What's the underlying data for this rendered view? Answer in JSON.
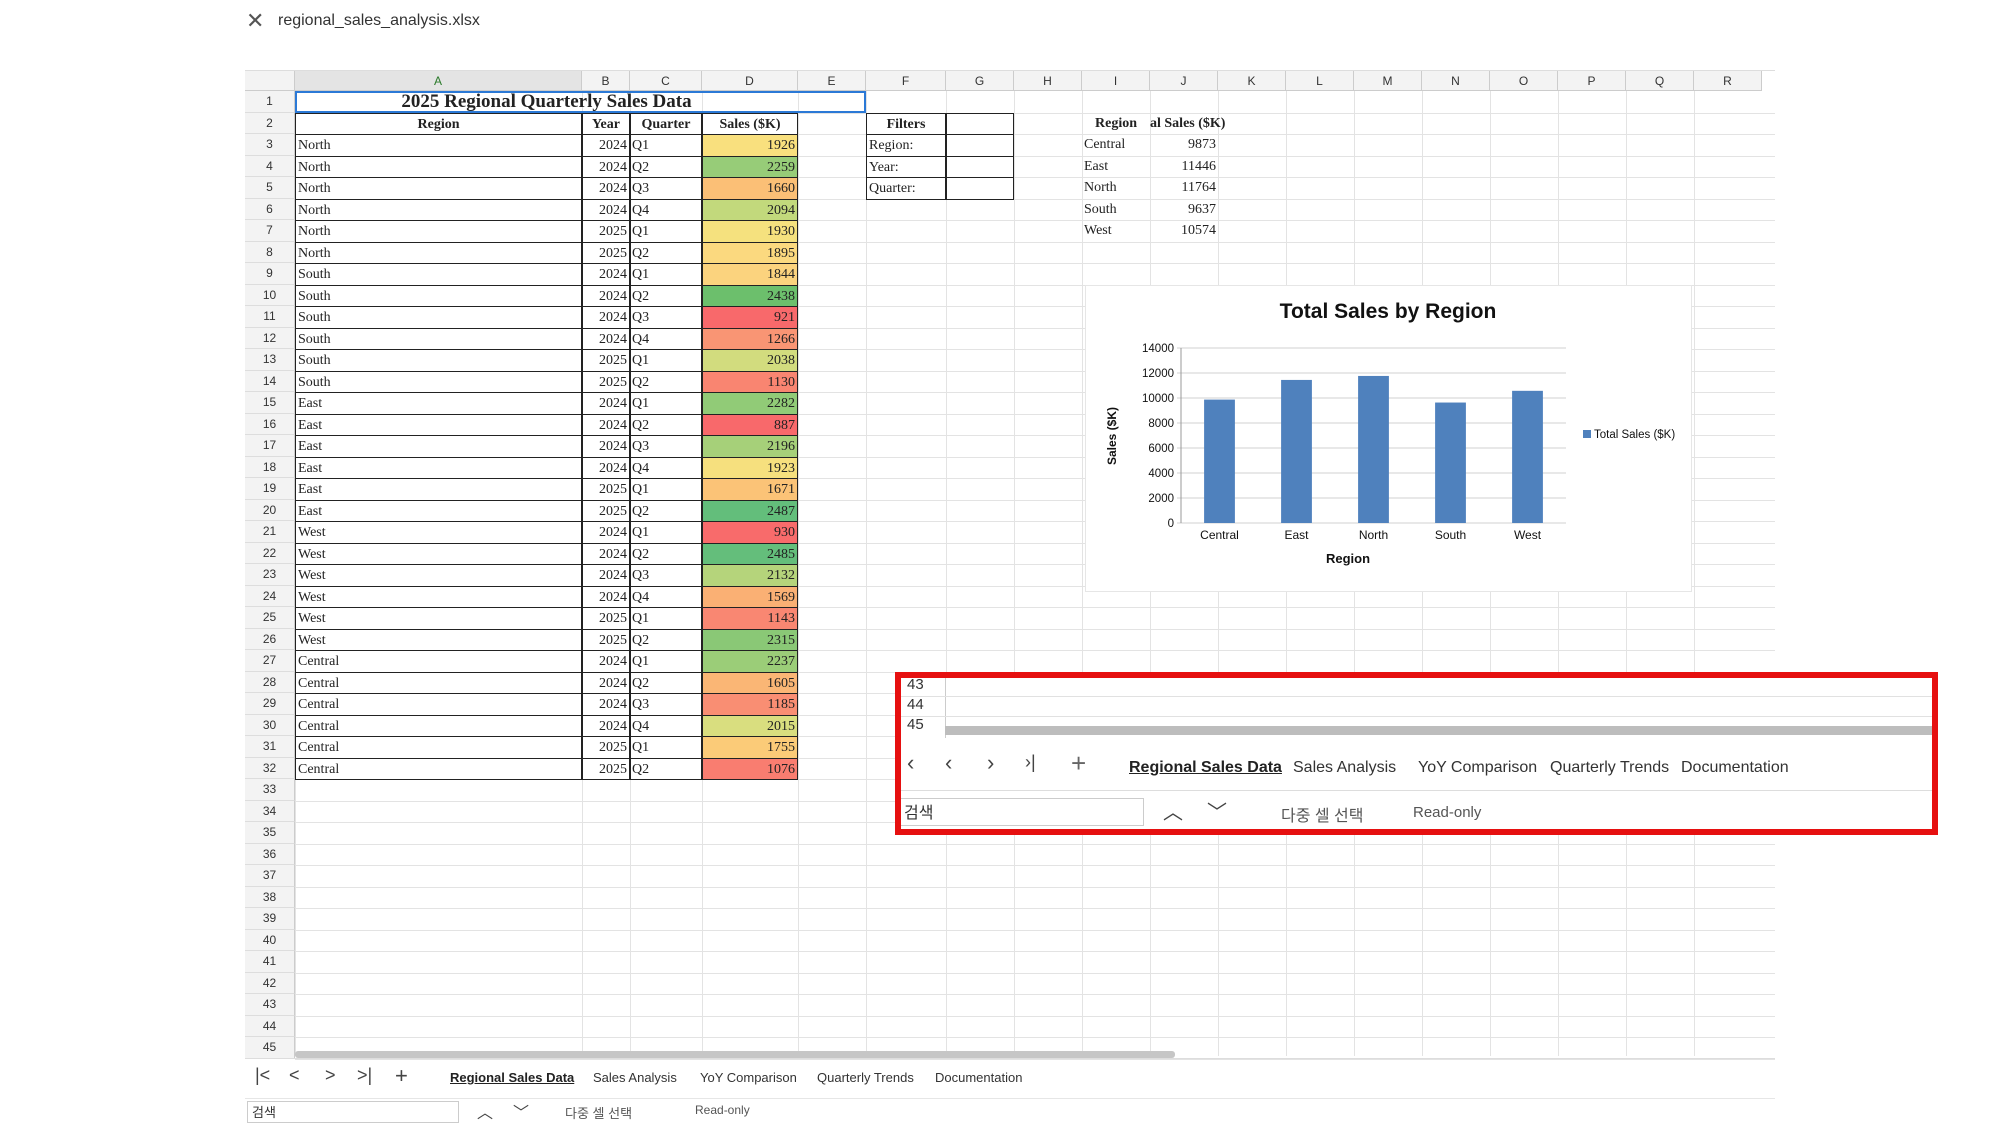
{
  "window": {
    "title": "regional_sales_analysis.xlsx",
    "close_icon": "close-icon"
  },
  "columns": [
    "A",
    "B",
    "C",
    "D",
    "E",
    "F",
    "G",
    "H",
    "I",
    "J",
    "K",
    "L",
    "M",
    "N",
    "O",
    "P",
    "Q",
    "R"
  ],
  "row_numbers": [
    "1",
    "2",
    "3",
    "4",
    "5",
    "6",
    "7",
    "8",
    "9",
    "10",
    "11",
    "12",
    "13",
    "14",
    "15",
    "16",
    "17",
    "18",
    "19",
    "20",
    "21",
    "22",
    "23",
    "24",
    "25",
    "26",
    "27",
    "28",
    "29",
    "30",
    "31",
    "32",
    "33",
    "34",
    "35",
    "36",
    "37",
    "38",
    "39",
    "40",
    "41",
    "42",
    "43",
    "44",
    "45"
  ],
  "sheet": {
    "title": "2025 Regional Quarterly Sales Data",
    "headers": {
      "region": "Region",
      "year": "Year",
      "quarter": "Quarter",
      "sales": "Sales ($K)"
    },
    "rows": [
      {
        "region": "North",
        "year": "2024",
        "quarter": "Q1",
        "sales": "1926",
        "color": "#f9e07e"
      },
      {
        "region": "North",
        "year": "2024",
        "quarter": "Q2",
        "sales": "2259",
        "color": "#97cc78"
      },
      {
        "region": "North",
        "year": "2024",
        "quarter": "Q3",
        "sales": "1660",
        "color": "#fbbf76"
      },
      {
        "region": "North",
        "year": "2024",
        "quarter": "Q4",
        "sales": "2094",
        "color": "#c2d97c"
      },
      {
        "region": "North",
        "year": "2025",
        "quarter": "Q1",
        "sales": "1930",
        "color": "#f5e17e"
      },
      {
        "region": "North",
        "year": "2025",
        "quarter": "Q2",
        "sales": "1895",
        "color": "#fbd97f"
      },
      {
        "region": "South",
        "year": "2024",
        "quarter": "Q1",
        "sales": "1844",
        "color": "#fbd37e"
      },
      {
        "region": "South",
        "year": "2024",
        "quarter": "Q2",
        "sales": "2438",
        "color": "#6cbf6c"
      },
      {
        "region": "South",
        "year": "2024",
        "quarter": "Q3",
        "sales": "921",
        "color": "#f8696b"
      },
      {
        "region": "South",
        "year": "2024",
        "quarter": "Q4",
        "sales": "1266",
        "color": "#f99574"
      },
      {
        "region": "South",
        "year": "2025",
        "quarter": "Q1",
        "sales": "2038",
        "color": "#d2dc7e"
      },
      {
        "region": "South",
        "year": "2025",
        "quarter": "Q2",
        "sales": "1130",
        "color": "#f98571"
      },
      {
        "region": "East",
        "year": "2024",
        "quarter": "Q1",
        "sales": "2282",
        "color": "#91cb77"
      },
      {
        "region": "East",
        "year": "2024",
        "quarter": "Q2",
        "sales": "887",
        "color": "#f8696b"
      },
      {
        "region": "East",
        "year": "2024",
        "quarter": "Q3",
        "sales": "2196",
        "color": "#a6d079"
      },
      {
        "region": "East",
        "year": "2024",
        "quarter": "Q4",
        "sales": "1923",
        "color": "#f6e07e"
      },
      {
        "region": "East",
        "year": "2025",
        "quarter": "Q1",
        "sales": "1671",
        "color": "#fbc377"
      },
      {
        "region": "East",
        "year": "2025",
        "quarter": "Q2",
        "sales": "2487",
        "color": "#63be7b"
      },
      {
        "region": "West",
        "year": "2024",
        "quarter": "Q1",
        "sales": "930",
        "color": "#f86b6b"
      },
      {
        "region": "West",
        "year": "2024",
        "quarter": "Q2",
        "sales": "2485",
        "color": "#64be7b"
      },
      {
        "region": "West",
        "year": "2024",
        "quarter": "Q3",
        "sales": "2132",
        "color": "#b5d47b"
      },
      {
        "region": "West",
        "year": "2024",
        "quarter": "Q4",
        "sales": "1569",
        "color": "#fab074"
      },
      {
        "region": "West",
        "year": "2025",
        "quarter": "Q1",
        "sales": "1143",
        "color": "#f98772"
      },
      {
        "region": "West",
        "year": "2025",
        "quarter": "Q2",
        "sales": "2315",
        "color": "#8ac876"
      },
      {
        "region": "Central",
        "year": "2024",
        "quarter": "Q1",
        "sales": "2237",
        "color": "#9bcd78"
      },
      {
        "region": "Central",
        "year": "2024",
        "quarter": "Q2",
        "sales": "1605",
        "color": "#fab675"
      },
      {
        "region": "Central",
        "year": "2024",
        "quarter": "Q3",
        "sales": "1185",
        "color": "#f98e73"
      },
      {
        "region": "Central",
        "year": "2024",
        "quarter": "Q4",
        "sales": "2015",
        "color": "#d9de7f"
      },
      {
        "region": "Central",
        "year": "2025",
        "quarter": "Q1",
        "sales": "1755",
        "color": "#fbcb78"
      },
      {
        "region": "Central",
        "year": "2025",
        "quarter": "Q2",
        "sales": "1076",
        "color": "#f97d70"
      }
    ]
  },
  "filters": {
    "title": "Filters",
    "labels": [
      "Region:",
      "Year:",
      "Quarter:"
    ]
  },
  "summary": {
    "header_region": "Region",
    "header_total": "al Sales ($K)",
    "rows": [
      {
        "region": "Central",
        "total": "9873"
      },
      {
        "region": "East",
        "total": "11446"
      },
      {
        "region": "North",
        "total": "11764"
      },
      {
        "region": "South",
        "total": "9637"
      },
      {
        "region": "West",
        "total": "10574"
      }
    ]
  },
  "chart_data": {
    "type": "bar",
    "title": "Total Sales by Region",
    "xlabel": "Region",
    "ylabel": "Sales ($K)",
    "categories": [
      "Central",
      "East",
      "North",
      "South",
      "West"
    ],
    "series": [
      {
        "name": "Total Sales ($K)",
        "values": [
          9873,
          11446,
          11764,
          9637,
          10574
        ]
      }
    ],
    "ylim": [
      0,
      14000
    ],
    "yticks": [
      "0",
      "2000",
      "4000",
      "6000",
      "8000",
      "10000",
      "12000",
      "14000"
    ],
    "bar_color": "#4f81bd",
    "legend": "right",
    "grid": true
  },
  "tabs": [
    "Regional Sales Data",
    "Sales Analysis",
    "YoY Comparison",
    "Quarterly Trends",
    "Documentation"
  ],
  "active_tab": "Regional Sales Data",
  "status": {
    "search_placeholder": "검색",
    "multi_select": "다중 셀 선택",
    "mode": "Read-only"
  },
  "zoom": {
    "rows": [
      "43",
      "44",
      "45"
    ]
  },
  "highlight_color": "#e61010"
}
